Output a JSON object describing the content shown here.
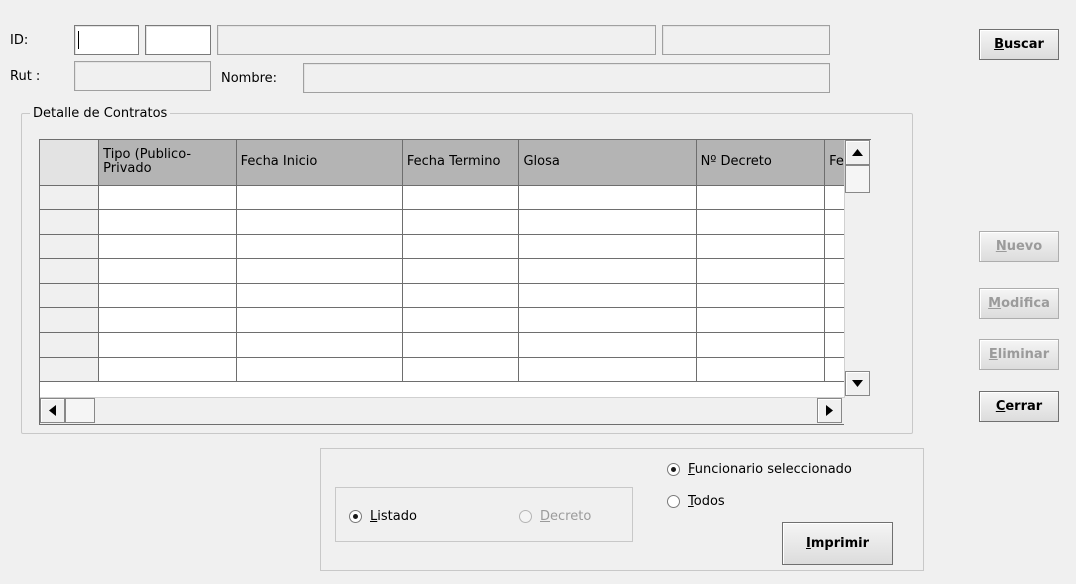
{
  "header": {
    "id_label": "ID:",
    "rut_label": "Rut :",
    "nombre_label": "Nombre:",
    "id_value_1": "",
    "id_value_2": "",
    "id_value_3": "",
    "id_value_4": "",
    "rut_value": "",
    "nombre_value": ""
  },
  "buttons": {
    "buscar": {
      "accel": "B",
      "rest": "uscar"
    },
    "nuevo": {
      "accel": "N",
      "rest": "uevo"
    },
    "modifica": {
      "accel": "M",
      "rest": "odifica"
    },
    "eliminar": {
      "accel": "E",
      "rest": "liminar"
    },
    "cerrar": {
      "accel": "C",
      "rest": "errar"
    },
    "imprimir": {
      "accel": "I",
      "rest": "mprimir"
    }
  },
  "detalle": {
    "legend": "Detalle de Contratos",
    "columns": [
      "",
      "Tipo (Publico-Privado",
      "Fecha Inicio",
      "Fecha Termino",
      "Glosa",
      "Nº Decreto",
      "Fe"
    ],
    "row_count": 8
  },
  "report": {
    "listado": "Listado",
    "decreto": "Decreto",
    "funcionario": "Funcionario seleccionado",
    "todos": "Todos",
    "listado_selected": true,
    "funcionario_selected": true
  }
}
